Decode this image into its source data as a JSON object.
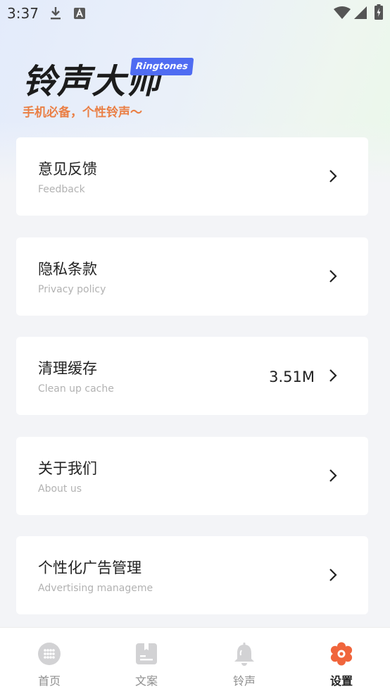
{
  "status_bar": {
    "time": "3:37"
  },
  "header": {
    "app_title": "铃声大师",
    "badge": "Ringtones",
    "slogan": "手机必备，个性铃声～"
  },
  "menu": [
    {
      "title": "意见反馈",
      "subtitle": "Feedback",
      "value": ""
    },
    {
      "title": "隐私条款",
      "subtitle": "Privacy policy",
      "value": ""
    },
    {
      "title": "清理缓存",
      "subtitle": "Clean up cache",
      "value": "3.51M"
    },
    {
      "title": "关于我们",
      "subtitle": "About us",
      "value": ""
    },
    {
      "title": "个性化广告管理",
      "subtitle": "Advertising manageme",
      "value": ""
    }
  ],
  "bottom_nav": [
    {
      "label": "首页",
      "icon": "grid-dots-icon",
      "active": false
    },
    {
      "label": "文案",
      "icon": "notebook-icon",
      "active": false
    },
    {
      "label": "铃声",
      "icon": "bell-icon",
      "active": false
    },
    {
      "label": "设置",
      "icon": "settings-flower-icon",
      "active": true
    }
  ],
  "colors": {
    "accent": "#f0653c",
    "badge": "#4f6cf2",
    "slogan": "#ea7f45",
    "inactive_icon": "#d2d2d4"
  }
}
